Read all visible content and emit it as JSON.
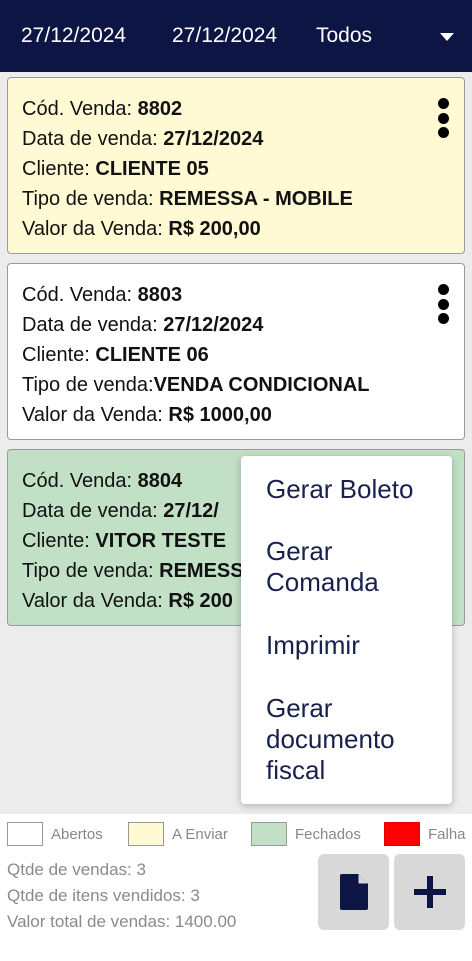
{
  "header": {
    "date_start": "27/12/2024",
    "date_end": "27/12/2024",
    "filter_label": "Todos",
    "background": "#0d1545"
  },
  "cards": [
    {
      "status_color": "#fffad4",
      "code_label": "Cód. Venda: ",
      "code": "8802",
      "date_label": "Data de venda: ",
      "date": "27/12/2024",
      "client_label": "Cliente: ",
      "client": "CLIENTE 05",
      "type_label": "Tipo de venda: ",
      "type": "REMESSA - MOBILE",
      "value_label": "Valor da Venda: ",
      "value": "R$ 200,00"
    },
    {
      "status_color": "#ffffff",
      "code_label": "Cód. Venda: ",
      "code": "8803",
      "date_label": "Data de venda: ",
      "date": "27/12/2024",
      "client_label": "Cliente: ",
      "client": "CLIENTE 06",
      "type_label": "Tipo de venda:",
      "type": "VENDA CONDICIONAL",
      "value_label": "Valor da Venda: ",
      "value": "R$ 1000,00"
    },
    {
      "status_color": "#c2e0c6",
      "code_label": "Cód. Venda: ",
      "code": "8804",
      "date_label": "Data de venda: ",
      "date": "27/12/",
      "client_label": "Cliente: ",
      "client": "VITOR TESTE",
      "type_label": "Tipo de venda: ",
      "type": "REMESS",
      "value_label": "Valor da Venda: ",
      "value": "R$ 200"
    }
  ],
  "context_menu": {
    "items": [
      "Gerar Boleto",
      "Gerar Comanda",
      "Imprimir",
      "Gerar documento fiscal"
    ]
  },
  "legend": [
    {
      "label": "Abertos",
      "color": "#ffffff"
    },
    {
      "label": "A Enviar",
      "color": "#fffad4"
    },
    {
      "label": "Fechados",
      "color": "#c2e0c6"
    },
    {
      "label": "Falha",
      "color": "#ff0000"
    }
  ],
  "stats": {
    "sales_count": "Qtde de vendas: 3",
    "items_count": "Qtde de itens vendidos: 3",
    "total_value": "Valor total de vendas: 1400.00"
  },
  "icons": {
    "menu_caret": "caret-down-icon",
    "card_menu": "kebab-menu-icon",
    "document": "document-icon",
    "add": "plus-icon"
  }
}
